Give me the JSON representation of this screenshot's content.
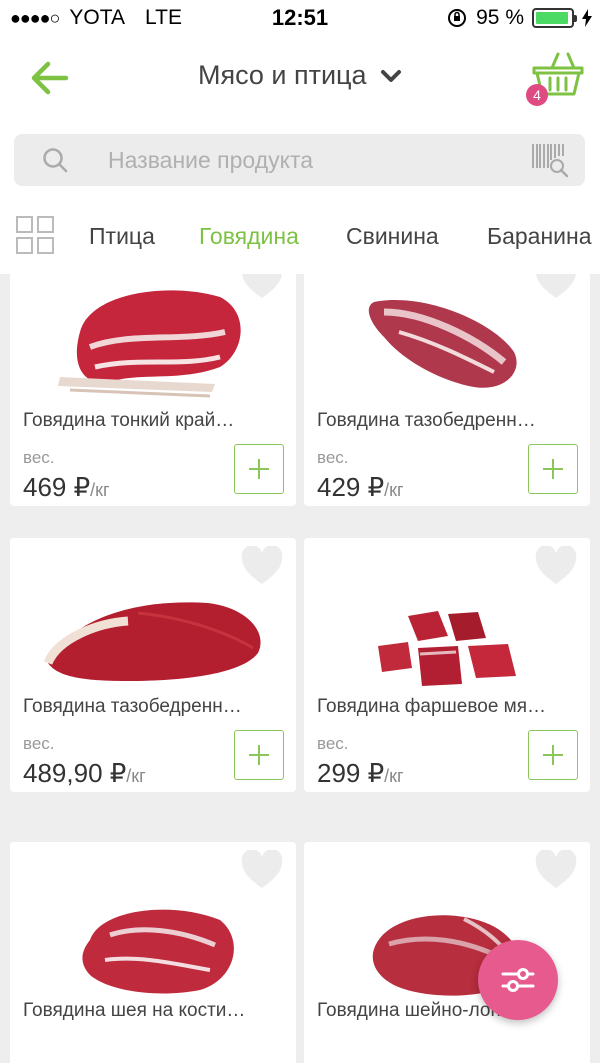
{
  "status_bar": {
    "signal_dots": "●●●●○",
    "carrier": "YOTA",
    "network": "LTE",
    "time": "12:51",
    "battery_percent": "95 %",
    "battery_level": 0.95
  },
  "header": {
    "title": "Мясо и птица",
    "cart_count": "4",
    "icons": {
      "back": "arrow-left-icon",
      "dropdown": "chevron-down-icon",
      "cart": "basket-icon"
    },
    "accent_color": "#7dc242"
  },
  "search": {
    "placeholder": "Название продукта",
    "icons": {
      "search": "search-icon",
      "barcode": "barcode-scanner-icon"
    }
  },
  "tabs": {
    "grid_icon": "grid-view-icon",
    "items": [
      {
        "label": "Птица",
        "active": false
      },
      {
        "label": "Говядина",
        "active": true
      },
      {
        "label": "Свинина",
        "active": false
      },
      {
        "label": "Баранина",
        "active": false
      }
    ]
  },
  "products": [
    {
      "name": "Говядина тонкий край…",
      "weight_label": "вес.",
      "price": "469 ₽",
      "unit": "/кг"
    },
    {
      "name": "Говядина тазобедренн…",
      "weight_label": "вес.",
      "price": "429 ₽",
      "unit": "/кг"
    },
    {
      "name": "Говядина тазобедренн…",
      "weight_label": "вес.",
      "price": "489,90 ₽",
      "unit": "/кг"
    },
    {
      "name": "Говядина фаршевое мя…",
      "weight_label": "вес.",
      "price": "299 ₽",
      "unit": "/кг"
    },
    {
      "name": "Говядина шея на кости…",
      "weight_label": "",
      "price": "",
      "unit": ""
    },
    {
      "name": "Говядина шейно-лопат…",
      "weight_label": "",
      "price": "",
      "unit": ""
    }
  ],
  "fab": {
    "icon": "filter-sliders-icon",
    "color": "#e75a8e"
  }
}
